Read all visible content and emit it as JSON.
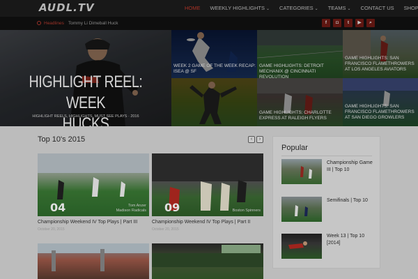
{
  "site": {
    "logo": "AUDL.TV"
  },
  "nav": {
    "items": [
      {
        "label": "HOME",
        "has_dropdown": false,
        "active": true
      },
      {
        "label": "WEEKLY HIGHLIGHTS",
        "has_dropdown": true,
        "active": false
      },
      {
        "label": "CATEGORIES",
        "has_dropdown": true,
        "active": false
      },
      {
        "label": "TEAMS",
        "has_dropdown": true,
        "active": false
      },
      {
        "label": "CONTACT US",
        "has_dropdown": false,
        "active": false
      },
      {
        "label": "SHOP",
        "has_dropdown": false,
        "active": false
      }
    ]
  },
  "headline_bar": {
    "label": "Headlines",
    "text": "Tommy Li Dimeball Huck",
    "socials": [
      "facebook-icon",
      "instagram-icon",
      "twitter-icon",
      "youtube-icon",
      "search-icon"
    ]
  },
  "hero": {
    "main": {
      "title_line1": "HIGHLIGHT REEL: WEEK",
      "title_line2": "HUCKS",
      "subtitle": "HIGHLIGHT REELS, HIGHLIGHTS, MUST SEE PLAYS · 2016"
    },
    "tiles": [
      {
        "caption": "WEEK 2 GAME OF THE WEEK RECAP: ISEA @ SF"
      },
      {
        "caption": "GAME HIGHLIGHTS: DETROIT MECHANIX @ CINCINNATI REVOLUTION"
      },
      {
        "caption": "GAME HIGHLIGHTS: SAN FRANCISCO FLAMETHROWERS AT LOS ANGELES AVIATORS"
      },
      {
        "caption": ""
      },
      {
        "caption": "GAME HIGHLIGHTS: CHARLOTTE EXPRESS AT RALEIGH FLYERS"
      },
      {
        "caption": "GAME HIGHLIGHTS: SAN FRANCISCO FLAMETHROWERS AT SAN DIEGO GROWLERS"
      }
    ]
  },
  "top10": {
    "title": "Top 10's 2015",
    "prev_label": "‹",
    "next_label": "›",
    "cards": [
      {
        "title": "Championship Weekend IV Top Plays | Part III",
        "date": "October 20, 2015",
        "number": "04",
        "overlay": "Tom Anzer\nMadison Radicals"
      },
      {
        "title": "Championship Weekend IV Top Plays | Part II",
        "date": "October 20, 2015",
        "number": "09",
        "overlay": "Boston Spinners"
      },
      {
        "title": "",
        "date": "",
        "number": "",
        "overlay": ""
      },
      {
        "title": "",
        "date": "",
        "number": "",
        "overlay": ""
      }
    ]
  },
  "popular": {
    "title": "Popular",
    "items": [
      {
        "label": "Championship Game III | Top 10"
      },
      {
        "label": "Semifinals | Top 10"
      },
      {
        "label": "Week 13 | Top 10 [2014]"
      }
    ]
  }
}
